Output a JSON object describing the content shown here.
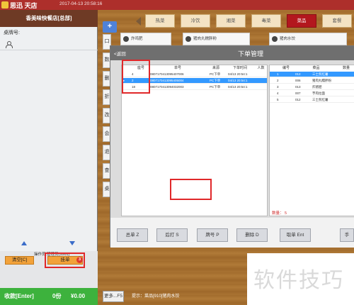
{
  "topbar": {
    "brand": "思迅 天店",
    "datetime": "2017-04-13 20:58:16"
  },
  "left": {
    "store_name": "香美味快餐店[总部]",
    "table_no_label": "桌牌号:",
    "operator": "操作员:管理员(1001)",
    "clear_label": "清空[C]",
    "hold_label": "挂单",
    "hold_badge": "3",
    "checkout_label": "收款[Enter]",
    "checkout_count": "0份",
    "checkout_amount": "¥0.00"
  },
  "add_button": "+",
  "side_tabs": [
    "口",
    "数",
    "删",
    "折",
    "改",
    "会",
    "退",
    "查",
    "桌"
  ],
  "categories": [
    "热菜",
    "冷饮",
    "湘菜",
    "毒菜",
    "菜品",
    "套餐"
  ],
  "active_category_index": 4,
  "menu_cards": [
    "炸鸡肥",
    "猪肉丸糯胖粉",
    "猪肉水饺"
  ],
  "dialog": {
    "back_label": "<返回",
    "title": "下单管理",
    "left_headers": [
      "",
      "座号",
      "单号",
      "来源",
      "下单时间",
      "人数"
    ],
    "orders": [
      {
        "seq": "4",
        "order_no": "0807170413095407006",
        "source": "PC下单",
        "time": "04/13 20:54:1",
        "selected": false
      },
      {
        "seq": "2",
        "order_no": "0807170413095405004",
        "source": "PC下单",
        "time": "04/13 20:54:1",
        "selected": true
      },
      {
        "seq": "18",
        "order_no": "0807170413094032003",
        "source": "PC下单",
        "time": "04/13 20:54:1",
        "selected": false
      }
    ],
    "right_headers": [
      "",
      "编号",
      "菜品",
      "数量"
    ],
    "items": [
      {
        "idx": "1",
        "code": "012",
        "name": "三士煎红薯",
        "selected": true
      },
      {
        "idx": "2",
        "code": "006",
        "name": "猪肉丸糯胖粉",
        "selected": false
      },
      {
        "idx": "3",
        "code": "013",
        "name": "炸猪肥",
        "selected": false
      },
      {
        "idx": "4",
        "code": "007",
        "name": "芋肉拉面",
        "selected": false
      },
      {
        "idx": "5",
        "code": "012",
        "name": "三士煎红薯",
        "selected": false
      }
    ],
    "total_label": "数量：",
    "total_value": "5",
    "buttons": [
      "总单 Z",
      "后打 S",
      "牌号 P",
      "删除 D",
      "取单 Ent",
      "手"
    ]
  },
  "bottom": {
    "more_label": "更多...F5",
    "hint": "提示：菜品[910]猪肉水饺"
  },
  "watermark": "软件技巧"
}
